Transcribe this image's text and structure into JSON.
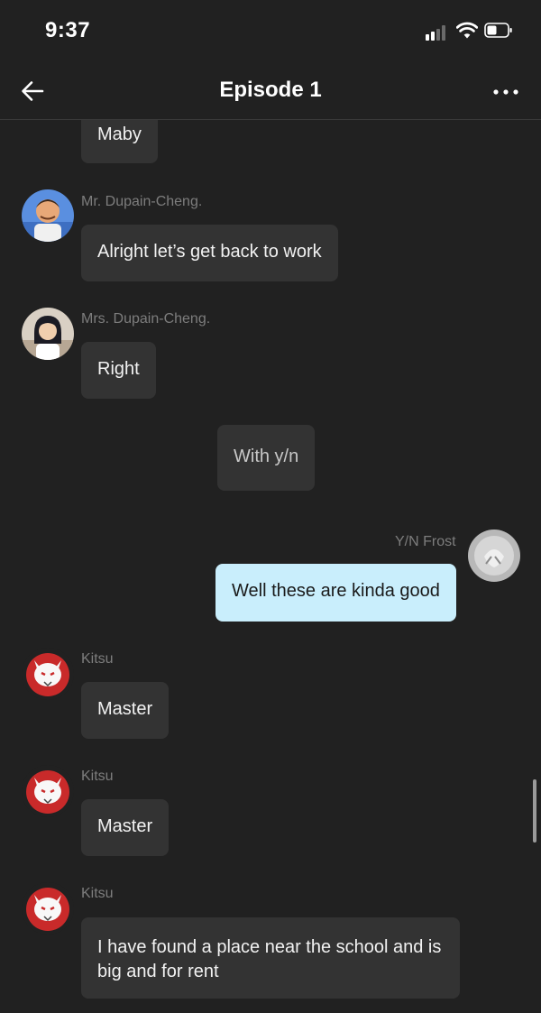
{
  "status_bar": {
    "time": "9:37",
    "icons": [
      "signal-icon",
      "wifi-icon",
      "battery-icon"
    ]
  },
  "header": {
    "title": "Episode 1",
    "back_icon": "arrow-left-icon",
    "more_icon": "more-horizontal-icon"
  },
  "colors": {
    "background": "#212121",
    "bubble": "#333333",
    "self_bubble": "#c9eefc",
    "name_text": "#7d7d7d"
  },
  "messages": [
    {
      "sender": "",
      "text": "Maby",
      "type": "other"
    },
    {
      "sender": "Mr. Dupain-Cheng.",
      "text": "Alright let’s get back to work",
      "type": "other"
    },
    {
      "sender": "Mrs. Dupain-Cheng.",
      "text": "Right",
      "type": "other"
    },
    {
      "sender": "",
      "text": "With y/n",
      "type": "narration"
    },
    {
      "sender": "Y/N Frost",
      "text": "Well these are kinda good",
      "type": "self"
    },
    {
      "sender": "Kitsu",
      "text": "Master",
      "type": "other"
    },
    {
      "sender": "Kitsu",
      "text": "Master",
      "type": "other"
    },
    {
      "sender": "Kitsu",
      "text": "I have found a place near the school and is big and for rent",
      "type": "other"
    }
  ]
}
